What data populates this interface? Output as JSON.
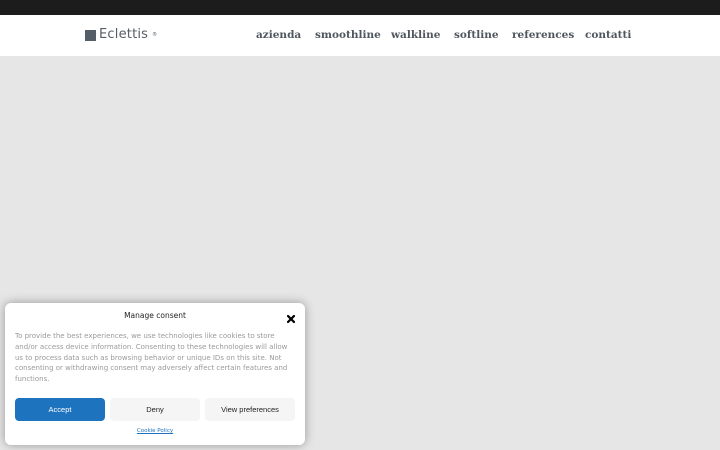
{
  "header": {
    "logo_text": "Eclettis",
    "logo_mark": "®",
    "nav": [
      {
        "label": "azienda"
      },
      {
        "label": "smoothline"
      },
      {
        "label": "walkline"
      },
      {
        "label": "softline"
      },
      {
        "label": "references"
      },
      {
        "label": "contatti"
      }
    ]
  },
  "consent": {
    "title": "Manage consent",
    "close_icon": "close-icon",
    "body": "To provide the best experiences, we use technologies like cookies to store and/or access device information. Consenting to these technologies will allow us to process data such as browsing behavior or unique IDs on this site. Not consenting or withdrawing consent may adversely affect certain features and functions.",
    "accept_label": "Accept",
    "deny_label": "Deny",
    "preferences_label": "View preferences",
    "policy_label": "Cookie Policy"
  },
  "colors": {
    "topbar": "#1c1c1c",
    "page_background": "#e6e6e6",
    "accent": "#1e73be",
    "nav_text": "#4f565e"
  }
}
